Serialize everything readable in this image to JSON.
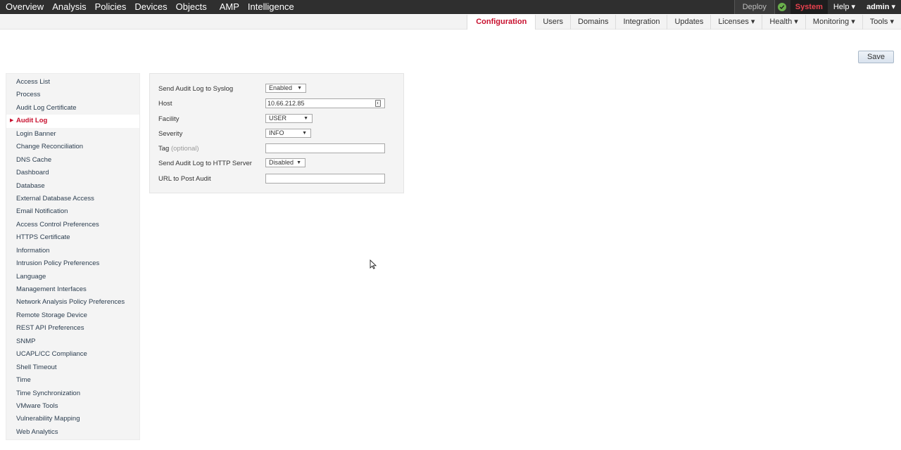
{
  "top_nav": {
    "items": [
      "Overview",
      "Analysis",
      "Policies",
      "Devices",
      "Objects",
      "AMP",
      "Intelligence"
    ],
    "deploy": "Deploy",
    "system": "System",
    "help": "Help ▾",
    "admin": "admin ▾",
    "status_icon": "check-circle-icon",
    "status_color": "#6ab04c",
    "system_color": "#e8414e"
  },
  "sub_nav": {
    "items": [
      "Configuration",
      "Users",
      "Domains",
      "Integration",
      "Updates",
      "Licenses ▾",
      "Health ▾",
      "Monitoring ▾",
      "Tools ▾"
    ],
    "active": "Configuration"
  },
  "save_label": "Save",
  "sidebar": {
    "items": [
      "Access List",
      "Process",
      "Audit Log Certificate",
      "Audit Log",
      "Login Banner",
      "Change Reconciliation",
      "DNS Cache",
      "Dashboard",
      "Database",
      "External Database Access",
      "Email Notification",
      "Access Control Preferences",
      "HTTPS Certificate",
      "Information",
      "Intrusion Policy Preferences",
      "Language",
      "Management Interfaces",
      "Network Analysis Policy Preferences",
      "Remote Storage Device",
      "REST API Preferences",
      "SNMP",
      "UCAPL/CC Compliance",
      "Shell Timeout",
      "Time",
      "Time Synchronization",
      "VMware Tools",
      "Vulnerability Mapping",
      "Web Analytics"
    ],
    "active": "Audit Log"
  },
  "form": {
    "syslog": {
      "label": "Send Audit Log to Syslog",
      "value": "Enabled"
    },
    "host": {
      "label": "Host",
      "value": "10.66.212.85"
    },
    "facility": {
      "label": "Facility",
      "value": "USER"
    },
    "severity": {
      "label": "Severity",
      "value": "INFO"
    },
    "tag": {
      "label": "Tag",
      "optional": "(optional)",
      "value": ""
    },
    "http": {
      "label": "Send Audit Log to HTTP Server",
      "value": "Disabled"
    },
    "url": {
      "label": "URL to Post Audit",
      "value": ""
    },
    "caret": "▼"
  }
}
